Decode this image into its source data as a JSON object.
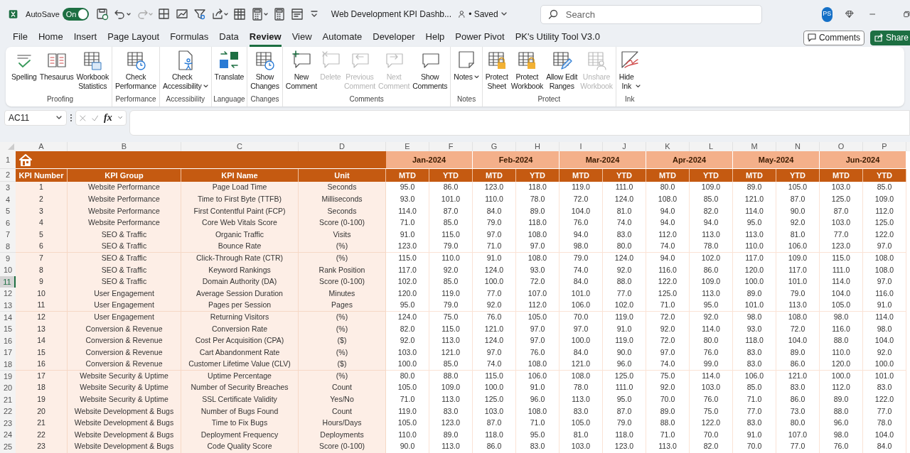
{
  "title_bar": {
    "autosave_label": "AutoSave",
    "autosave_toggle": {
      "label": "On",
      "on": true
    },
    "document_title": "Web Development KPI Dashb...",
    "save_status": "• Saved",
    "search_placeholder": "Search",
    "user_initials": "PS"
  },
  "menu_tabs": [
    {
      "label": "File",
      "selected": false
    },
    {
      "label": "Home",
      "selected": false
    },
    {
      "label": "Insert",
      "selected": false
    },
    {
      "label": "Page Layout",
      "selected": false
    },
    {
      "label": "Formulas",
      "selected": false
    },
    {
      "label": "Data",
      "selected": false
    },
    {
      "label": "Review",
      "selected": true
    },
    {
      "label": "View",
      "selected": false
    },
    {
      "label": "Automate",
      "selected": false
    },
    {
      "label": "Developer",
      "selected": false
    },
    {
      "label": "Help",
      "selected": false
    },
    {
      "label": "Power Pivot",
      "selected": false
    },
    {
      "label": "PK's Utility Tool V3.0",
      "selected": false
    }
  ],
  "header_buttons": [
    {
      "label": "Comments",
      "kind": "outline"
    },
    {
      "label": "Share",
      "kind": "primary"
    }
  ],
  "ribbon_groups": [
    {
      "label": "Proofing",
      "commands": [
        {
          "label": "Spelling",
          "kind": "spelling",
          "disabled": false,
          "dropdown": false
        },
        {
          "label": "Thesaurus",
          "kind": "thesaurus",
          "disabled": false,
          "dropdown": false
        },
        {
          "label": "Workbook\nStatistics",
          "kind": "statistics",
          "disabled": false,
          "dropdown": false
        }
      ]
    },
    {
      "label": "Performance",
      "commands": [
        {
          "label": "Check\nPerformance",
          "kind": "clock",
          "disabled": false,
          "dropdown": false
        }
      ]
    },
    {
      "label": "Accessibility",
      "commands": [
        {
          "label": "Check\nAccessibility",
          "kind": "accessibility",
          "disabled": false,
          "dropdown": true
        }
      ]
    },
    {
      "label": "Language",
      "commands": [
        {
          "label": "Translate",
          "kind": "translate",
          "disabled": false,
          "dropdown": false
        }
      ]
    },
    {
      "label": "Changes",
      "commands": [
        {
          "label": "Show\nChanges",
          "kind": "clock",
          "disabled": false,
          "dropdown": false
        }
      ]
    },
    {
      "label": "Comments",
      "commands": [
        {
          "label": "New\nComment",
          "kind": "comment_new",
          "disabled": false,
          "dropdown": false
        },
        {
          "label": "Delete",
          "kind": "comment_delete",
          "disabled": true,
          "dropdown": false
        },
        {
          "label": "Previous\nComment",
          "kind": "comment_prev",
          "disabled": true,
          "dropdown": false
        },
        {
          "label": "Next\nComment",
          "kind": "comment_next",
          "disabled": true,
          "dropdown": false
        },
        {
          "label": "Show\nComments",
          "kind": "comment",
          "disabled": false,
          "dropdown": false
        }
      ]
    },
    {
      "label": "Notes",
      "commands": [
        {
          "label": "Notes",
          "kind": "note",
          "disabled": false,
          "dropdown": true
        }
      ]
    },
    {
      "label": "Protect",
      "commands": [
        {
          "label": "Protect\nSheet",
          "kind": "lock",
          "disabled": false,
          "dropdown": false
        },
        {
          "label": "Protect\nWorkbook",
          "kind": "lock",
          "disabled": false,
          "dropdown": false
        },
        {
          "label": "Allow Edit\nRanges",
          "kind": "pencil",
          "disabled": false,
          "dropdown": false
        },
        {
          "label": "Unshare\nWorkbook",
          "kind": "person",
          "disabled": true,
          "dropdown": false
        }
      ]
    },
    {
      "label": "Ink",
      "commands": [
        {
          "label": "Hide\nInk",
          "kind": "ink",
          "disabled": false,
          "dropdown": true
        }
      ]
    }
  ],
  "formula_bar": {
    "name_box": "AC11",
    "function_label": "fx"
  },
  "sheet": {
    "column_letters": [
      "A",
      "B",
      "C",
      "D",
      "E",
      "F",
      "G",
      "H",
      "I",
      "J",
      "K",
      "L",
      "M",
      "N",
      "O",
      "P"
    ],
    "row_numbers": [
      {
        "label": "1",
        "selected": false
      },
      {
        "label": "2",
        "selected": false
      },
      {
        "label": "3",
        "selected": false
      },
      {
        "label": "4",
        "selected": false
      },
      {
        "label": "5",
        "selected": false
      },
      {
        "label": "6",
        "selected": false
      },
      {
        "label": "7",
        "selected": false
      },
      {
        "label": "8",
        "selected": false
      },
      {
        "label": "9",
        "selected": false
      },
      {
        "label": "10",
        "selected": false
      },
      {
        "label": "11",
        "selected": true
      },
      {
        "label": "12",
        "selected": false
      },
      {
        "label": "13",
        "selected": false
      },
      {
        "label": "14",
        "selected": false
      },
      {
        "label": "15",
        "selected": false
      },
      {
        "label": "16",
        "selected": false
      },
      {
        "label": "17",
        "selected": false
      },
      {
        "label": "18",
        "selected": false
      },
      {
        "label": "19",
        "selected": false
      },
      {
        "label": "20",
        "selected": false
      },
      {
        "label": "21",
        "selected": false
      },
      {
        "label": "22",
        "selected": false
      },
      {
        "label": "23",
        "selected": false
      },
      {
        "label": "24",
        "selected": false
      },
      {
        "label": "25",
        "selected": false
      }
    ],
    "month_headers": [
      "Jan-2024",
      "Feb-2024",
      "Mar-2024",
      "Apr-2024",
      "May-2024",
      "Jun-2024"
    ],
    "column_headers": [
      "KPI Number",
      "KPI Group",
      "KPI Name",
      "Unit",
      "MTD",
      "YTD",
      "MTD",
      "YTD",
      "MTD",
      "YTD",
      "MTD",
      "YTD",
      "MTD",
      "YTD",
      "MTD",
      "YTD"
    ],
    "rows": [
      {
        "kpi_number": "1",
        "kpi_group": "Website Performance",
        "kpi_name": "Page Load Time",
        "unit": "Seconds",
        "values": [
          "95.0",
          "86.0",
          "123.0",
          "118.0",
          "119.0",
          "111.0",
          "80.0",
          "109.0",
          "89.0",
          "105.0",
          "103.0",
          "85.0"
        ]
      },
      {
        "kpi_number": "2",
        "kpi_group": "Website Performance",
        "kpi_name": "Time to First Byte (TTFB)",
        "unit": "Milliseconds",
        "values": [
          "93.0",
          "101.0",
          "110.0",
          "78.0",
          "72.0",
          "124.0",
          "108.0",
          "85.0",
          "121.0",
          "87.0",
          "125.0",
          "109.0"
        ]
      },
      {
        "kpi_number": "3",
        "kpi_group": "Website Performance",
        "kpi_name": "First Contentful Paint (FCP)",
        "unit": "Seconds",
        "values": [
          "114.0",
          "87.0",
          "84.0",
          "89.0",
          "104.0",
          "81.0",
          "94.0",
          "82.0",
          "114.0",
          "90.0",
          "87.0",
          "112.0"
        ]
      },
      {
        "kpi_number": "4",
        "kpi_group": "Website Performance",
        "kpi_name": "Core Web Vitals Score",
        "unit": "Score (0-100)",
        "values": [
          "71.0",
          "85.0",
          "79.0",
          "118.0",
          "76.0",
          "74.0",
          "94.0",
          "94.0",
          "95.0",
          "92.0",
          "103.0",
          "125.0"
        ]
      },
      {
        "kpi_number": "5",
        "kpi_group": "SEO & Traffic",
        "kpi_name": "Organic Traffic",
        "unit": "Visits",
        "values": [
          "91.0",
          "115.0",
          "97.0",
          "108.0",
          "94.0",
          "83.0",
          "112.0",
          "113.0",
          "113.0",
          "81.0",
          "77.0",
          "122.0"
        ]
      },
      {
        "kpi_number": "6",
        "kpi_group": "SEO & Traffic",
        "kpi_name": "Bounce Rate",
        "unit": "(%)",
        "values": [
          "123.0",
          "79.0",
          "71.0",
          "97.0",
          "98.0",
          "80.0",
          "74.0",
          "78.0",
          "110.0",
          "106.0",
          "123.0",
          "97.0"
        ]
      },
      {
        "kpi_number": "7",
        "kpi_group": "SEO & Traffic",
        "kpi_name": "Click-Through Rate (CTR)",
        "unit": "(%)",
        "values": [
          "115.0",
          "110.0",
          "91.0",
          "108.0",
          "79.0",
          "124.0",
          "94.0",
          "102.0",
          "117.0",
          "109.0",
          "115.0",
          "108.0"
        ]
      },
      {
        "kpi_number": "8",
        "kpi_group": "SEO & Traffic",
        "kpi_name": "Keyword Rankings",
        "unit": "Rank Position",
        "values": [
          "117.0",
          "92.0",
          "124.0",
          "93.0",
          "74.0",
          "92.0",
          "116.0",
          "86.0",
          "120.0",
          "117.0",
          "111.0",
          "108.0"
        ]
      },
      {
        "kpi_number": "9",
        "kpi_group": "SEO & Traffic",
        "kpi_name": "Domain Authority (DA)",
        "unit": "Score (0-100)",
        "values": [
          "102.0",
          "85.0",
          "100.0",
          "72.0",
          "84.0",
          "88.0",
          "122.0",
          "109.0",
          "100.0",
          "101.0",
          "114.0",
          "97.0"
        ]
      },
      {
        "kpi_number": "10",
        "kpi_group": "User Engagement",
        "kpi_name": "Average Session Duration",
        "unit": "Minutes",
        "values": [
          "120.0",
          "119.0",
          "77.0",
          "107.0",
          "101.0",
          "77.0",
          "125.0",
          "113.0",
          "89.0",
          "79.0",
          "104.0",
          "116.0"
        ]
      },
      {
        "kpi_number": "11",
        "kpi_group": "User Engagement",
        "kpi_name": "Pages per Session",
        "unit": "Pages",
        "values": [
          "95.0",
          "79.0",
          "92.0",
          "112.0",
          "106.0",
          "102.0",
          "71.0",
          "95.0",
          "101.0",
          "113.0",
          "105.0",
          "91.0"
        ]
      },
      {
        "kpi_number": "12",
        "kpi_group": "User Engagement",
        "kpi_name": "Returning Visitors",
        "unit": "(%)",
        "values": [
          "124.0",
          "75.0",
          "76.0",
          "105.0",
          "70.0",
          "119.0",
          "72.0",
          "92.0",
          "98.0",
          "108.0",
          "98.0",
          "114.0"
        ]
      },
      {
        "kpi_number": "13",
        "kpi_group": "Conversion & Revenue",
        "kpi_name": "Conversion Rate",
        "unit": "(%)",
        "values": [
          "82.0",
          "115.0",
          "121.0",
          "97.0",
          "97.0",
          "91.0",
          "92.0",
          "114.0",
          "93.0",
          "72.0",
          "116.0",
          "98.0"
        ]
      },
      {
        "kpi_number": "14",
        "kpi_group": "Conversion & Revenue",
        "kpi_name": "Cost Per Acquisition (CPA)",
        "unit": "($)",
        "values": [
          "92.0",
          "113.0",
          "124.0",
          "97.0",
          "100.0",
          "119.0",
          "72.0",
          "80.0",
          "118.0",
          "104.0",
          "88.0",
          "104.0"
        ]
      },
      {
        "kpi_number": "15",
        "kpi_group": "Conversion & Revenue",
        "kpi_name": "Cart Abandonment Rate",
        "unit": "(%)",
        "values": [
          "103.0",
          "121.0",
          "97.0",
          "76.0",
          "84.0",
          "90.0",
          "97.0",
          "76.0",
          "83.0",
          "89.0",
          "110.0",
          "92.0"
        ]
      },
      {
        "kpi_number": "16",
        "kpi_group": "Conversion & Revenue",
        "kpi_name": "Customer Lifetime Value (CLV)",
        "unit": "($)",
        "values": [
          "100.0",
          "85.0",
          "74.0",
          "108.0",
          "121.0",
          "96.0",
          "74.0",
          "99.0",
          "83.0",
          "86.0",
          "120.0",
          "100.0"
        ]
      },
      {
        "kpi_number": "17",
        "kpi_group": "Website Security & Uptime",
        "kpi_name": "Uptime Percentage",
        "unit": "(%)",
        "values": [
          "80.0",
          "88.0",
          "115.0",
          "106.0",
          "108.0",
          "125.0",
          "75.0",
          "114.0",
          "106.0",
          "121.0",
          "100.0",
          "101.0"
        ]
      },
      {
        "kpi_number": "18",
        "kpi_group": "Website Security & Uptime",
        "kpi_name": "Number of Security Breaches",
        "unit": "Count",
        "values": [
          "105.0",
          "109.0",
          "100.0",
          "91.0",
          "78.0",
          "111.0",
          "92.0",
          "103.0",
          "85.0",
          "83.0",
          "112.0",
          "83.0"
        ]
      },
      {
        "kpi_number": "19",
        "kpi_group": "Website Security & Uptime",
        "kpi_name": "SSL Certificate Validity",
        "unit": "Yes/No",
        "values": [
          "71.0",
          "113.0",
          "125.0",
          "96.0",
          "113.0",
          "95.0",
          "70.0",
          "76.0",
          "71.0",
          "86.0",
          "89.0",
          "122.0"
        ]
      },
      {
        "kpi_number": "20",
        "kpi_group": "Website Development & Bugs",
        "kpi_name": "Number of Bugs Found",
        "unit": "Count",
        "values": [
          "119.0",
          "83.0",
          "103.0",
          "108.0",
          "83.0",
          "87.0",
          "89.0",
          "75.0",
          "77.0",
          "73.0",
          "88.0",
          "77.0"
        ]
      },
      {
        "kpi_number": "21",
        "kpi_group": "Website Development & Bugs",
        "kpi_name": "Time to Fix Bugs",
        "unit": "Hours/Days",
        "values": [
          "105.0",
          "123.0",
          "87.0",
          "71.0",
          "105.0",
          "79.0",
          "88.0",
          "122.0",
          "83.0",
          "80.0",
          "96.0",
          "78.0"
        ]
      },
      {
        "kpi_number": "22",
        "kpi_group": "Website Development & Bugs",
        "kpi_name": "Deployment Frequency",
        "unit": "Deployments",
        "values": [
          "110.0",
          "89.0",
          "118.0",
          "95.0",
          "81.0",
          "118.0",
          "71.0",
          "70.0",
          "91.0",
          "107.0",
          "98.0",
          "104.0"
        ]
      },
      {
        "kpi_number": "23",
        "kpi_group": "Website Development & Bugs",
        "kpi_name": "Code Quality Score",
        "unit": "Score (0-100)",
        "values": [
          "90.0",
          "113.0",
          "86.0",
          "83.0",
          "103.0",
          "123.0",
          "113.0",
          "82.0",
          "70.0",
          "77.0",
          "76.0",
          "84.0"
        ]
      }
    ]
  }
}
